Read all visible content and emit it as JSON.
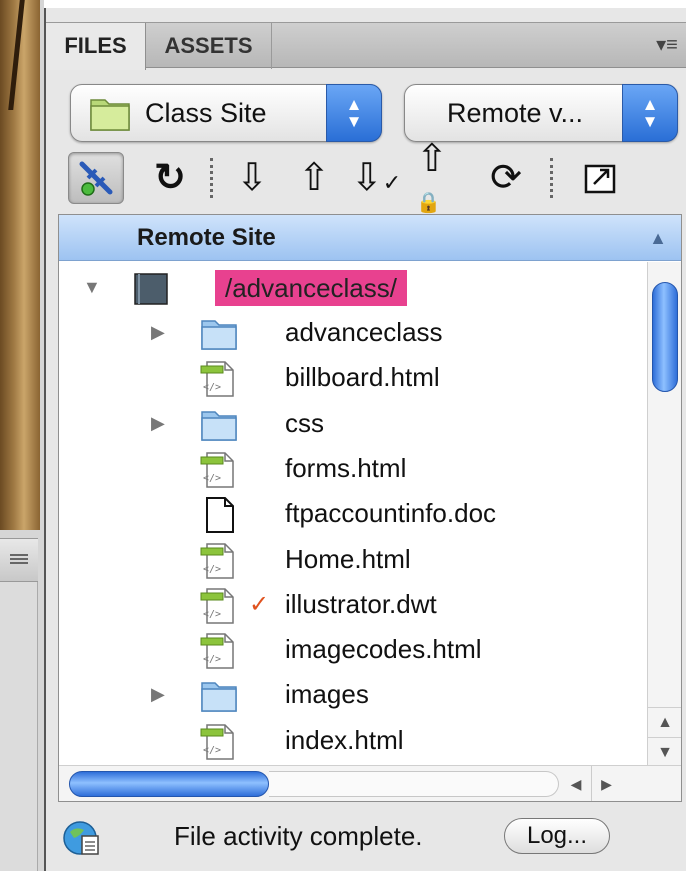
{
  "tabs": [
    {
      "label": "FILES",
      "active": true
    },
    {
      "label": "ASSETS",
      "active": false
    }
  ],
  "panel_menu_icon": "panel-options-icon",
  "site_select": {
    "value": "Class Site"
  },
  "view_select": {
    "value": "Remote v..."
  },
  "toolbar": {
    "icons": [
      "connect-icon",
      "refresh-icon",
      "get-files-icon",
      "put-files-icon",
      "check-out-icon",
      "check-in-icon",
      "synchronize-icon",
      "expand-icon"
    ]
  },
  "list": {
    "header": "Remote Site",
    "root": {
      "name": "/advanceclass/",
      "expanded": true
    },
    "items": [
      {
        "name": "advanceclass",
        "type": "folder",
        "expandable": true,
        "checked_out": false
      },
      {
        "name": "billboard.html",
        "type": "html",
        "expandable": false,
        "checked_out": false
      },
      {
        "name": "css",
        "type": "folder",
        "expandable": true,
        "checked_out": false
      },
      {
        "name": "forms.html",
        "type": "html",
        "expandable": false,
        "checked_out": false
      },
      {
        "name": "ftpaccountinfo.doc",
        "type": "doc",
        "expandable": false,
        "checked_out": false
      },
      {
        "name": "Home.html",
        "type": "html",
        "expandable": false,
        "checked_out": false
      },
      {
        "name": "illustrator.dwt",
        "type": "html",
        "expandable": false,
        "checked_out": true
      },
      {
        "name": "imagecodes.html",
        "type": "html",
        "expandable": false,
        "checked_out": false
      },
      {
        "name": "images",
        "type": "folder",
        "expandable": true,
        "checked_out": false
      },
      {
        "name": "index.html",
        "type": "html",
        "expandable": false,
        "checked_out": false
      }
    ]
  },
  "status": {
    "text": "File activity complete.",
    "log_label": "Log..."
  },
  "colors": {
    "accent_blue": "#2a6fd6",
    "root_highlight": "#e8418f",
    "header_blue": "#9dc3f1",
    "checkmark": "#e0521f"
  }
}
